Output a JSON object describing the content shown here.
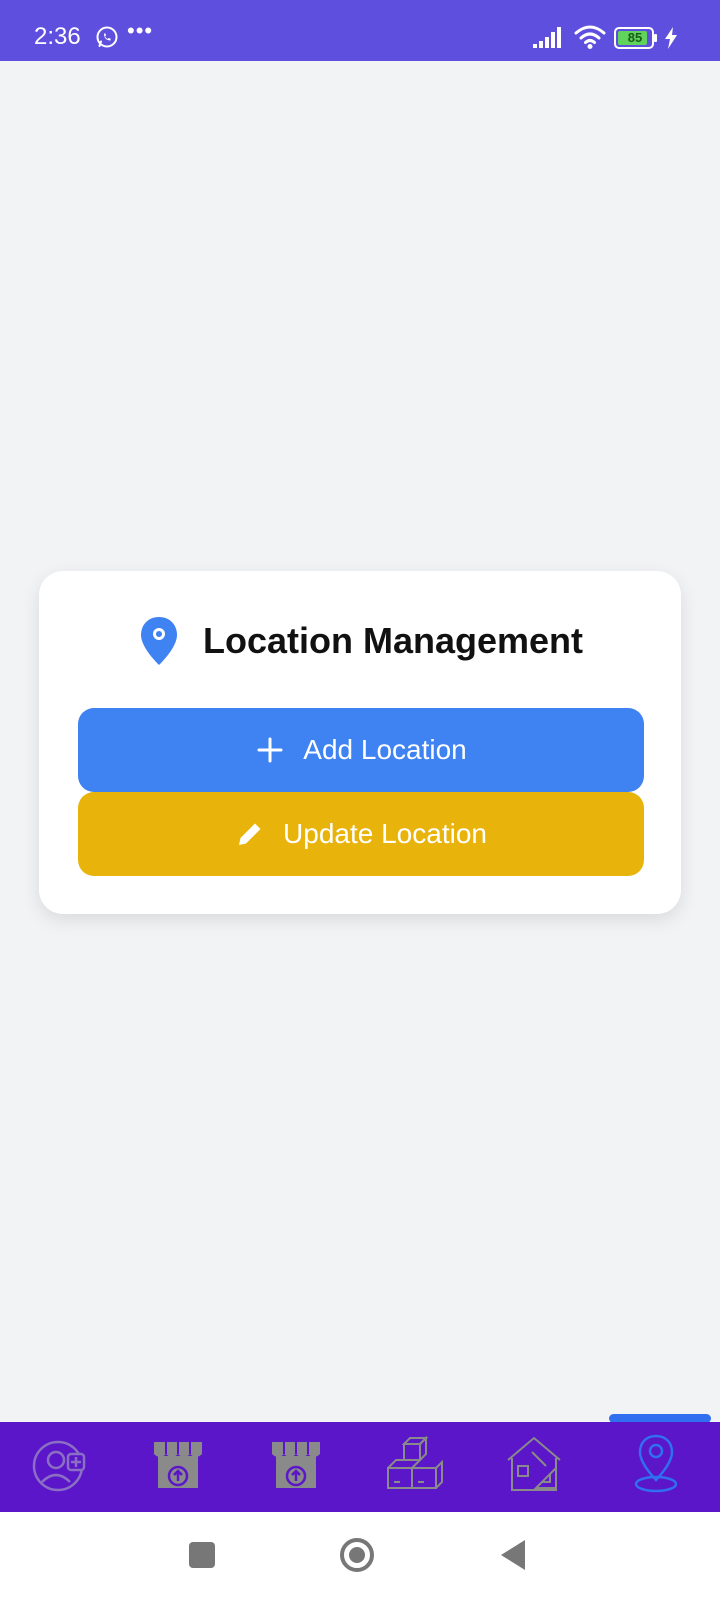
{
  "status_bar": {
    "time": "2:36",
    "battery": "85",
    "icons": [
      "whatsapp-icon",
      "more-icon",
      "signal-icon",
      "wifi-icon",
      "battery-icon",
      "charging-icon"
    ]
  },
  "card": {
    "title": "Location Management",
    "title_icon": "location-pin-icon",
    "add_button": {
      "label": "Add Location",
      "icon": "plus-icon",
      "color": "#3f82f2"
    },
    "update_button": {
      "label": "Update Location",
      "icon": "pencil-icon",
      "color": "#e8b40b"
    }
  },
  "bottom_nav": {
    "background": "#5a16c8",
    "active_color": "#2f6ff0",
    "items": [
      {
        "icon": "add-user-icon",
        "active": false
      },
      {
        "icon": "store-upload-icon",
        "active": false
      },
      {
        "icon": "store-upload-icon",
        "active": false
      },
      {
        "icon": "boxes-icon",
        "active": false
      },
      {
        "icon": "house-plan-icon",
        "active": false
      },
      {
        "icon": "location-pin-icon",
        "active": true
      }
    ]
  },
  "system_nav": {
    "icons": [
      "recents-icon",
      "home-icon",
      "back-icon"
    ]
  },
  "colors": {
    "status_bar": "#5f4fdf",
    "page_background": "#f2f3f5"
  }
}
